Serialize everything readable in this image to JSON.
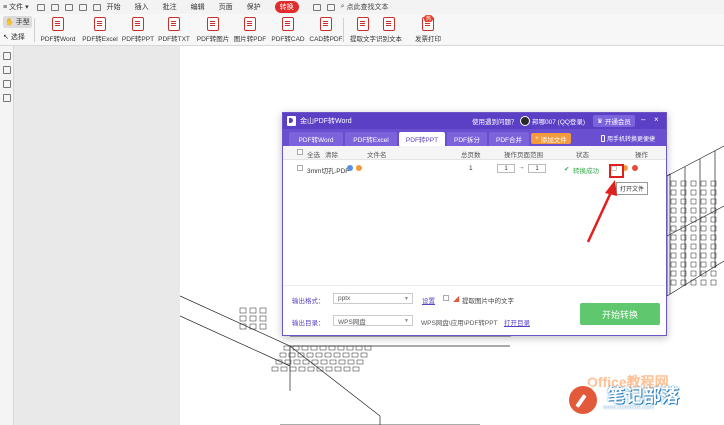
{
  "menubar": {
    "file_label": "文件",
    "tabs": [
      "开始",
      "插入",
      "批注",
      "编辑",
      "页面",
      "保护",
      "转换"
    ],
    "active_tab": "转换",
    "search_label": "点此查找文本"
  },
  "ribbon": {
    "hand_label": "手型",
    "select_label": "选择",
    "tools": [
      "PDF转Word",
      "PDF转Excel",
      "PDF转PPT",
      "PDF转TXT",
      "PDF转图片",
      "图片转PDF",
      "PDF转CAD",
      "CAD转PDF",
      "提取文字",
      "识别文本",
      "发票打印"
    ],
    "hot_badge": "热"
  },
  "dialog": {
    "title": "金山PDF转Word",
    "help": "使用遇到问题？",
    "user": "邦哪007 (QQ登录)",
    "vip_button": "开通会员",
    "tabs": [
      "PDF转Word",
      "PDF转Excel",
      "PDF转PPT",
      "PDF拆分",
      "PDF合并"
    ],
    "active_tab": "PDF转PPT",
    "add_file": "添加文件",
    "phone_link": "用手机转换更便捷",
    "headers": {
      "select_all": "全选",
      "clear": "清除",
      "filename": "文件名",
      "pages": "总页数",
      "range": "操作页面范围",
      "status": "状态",
      "action": "操作"
    },
    "rows": [
      {
        "filename": "3mm切孔.PDF",
        "pages": "1",
        "from": "1",
        "to": "1",
        "status": "转换成功"
      }
    ],
    "tooltip": "打开文件",
    "output_format_label": "输出格式：",
    "output_format_value": "pptx",
    "settings_link": "设置",
    "extract_images_label": "提取图片中的文字",
    "output_dir_label": "输出目录：",
    "output_dir_value": "WPS网盘",
    "output_path": "WPS网盘\\应用\\PDF转PPT",
    "open_dir_link": "打开目录",
    "start_button": "开始转换"
  },
  "watermark": {
    "office_text": "Office教程网",
    "brand": "笔记部落",
    "url": "www.notetribe.com"
  },
  "colors": {
    "dialog_purple": "#5b3fc4",
    "active_tab_red": "#e02c2c",
    "start_green": "#5fc86e",
    "highlight_red": "#e0201c",
    "add_orange": "#f39a3c"
  }
}
